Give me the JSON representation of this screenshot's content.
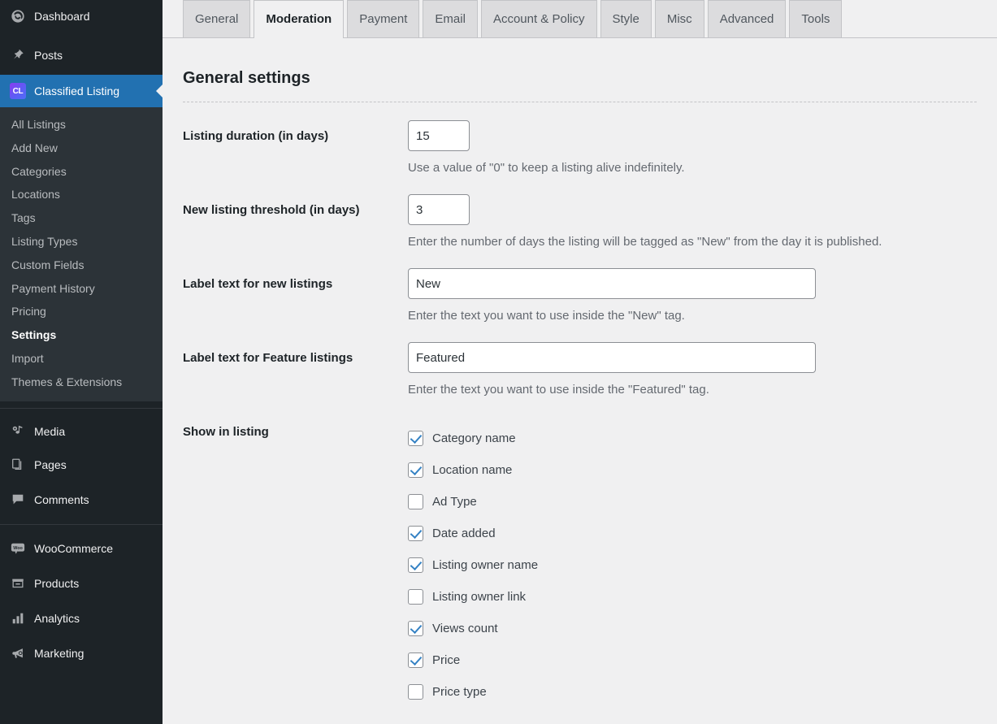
{
  "sidebar": {
    "items": [
      {
        "label": "Dashboard",
        "icon": "dashboard-icon",
        "name": "dashboard"
      },
      {
        "label": "Posts",
        "icon": "pin-icon",
        "name": "posts"
      },
      {
        "label": "Classified Listing",
        "icon": "cl-badge-icon",
        "name": "classified-listing",
        "active": true
      }
    ],
    "submenu": [
      {
        "label": "All Listings",
        "name": "all-listings"
      },
      {
        "label": "Add New",
        "name": "add-new"
      },
      {
        "label": "Categories",
        "name": "categories"
      },
      {
        "label": "Locations",
        "name": "locations"
      },
      {
        "label": "Tags",
        "name": "tags"
      },
      {
        "label": "Listing Types",
        "name": "listing-types"
      },
      {
        "label": "Custom Fields",
        "name": "custom-fields"
      },
      {
        "label": "Payment History",
        "name": "payment-history"
      },
      {
        "label": "Pricing",
        "name": "pricing"
      },
      {
        "label": "Settings",
        "name": "settings",
        "current": true
      },
      {
        "label": "Import",
        "name": "import"
      },
      {
        "label": "Themes & Extensions",
        "name": "themes-extensions"
      }
    ],
    "items_lower": [
      {
        "label": "Media",
        "icon": "media-icon",
        "name": "media"
      },
      {
        "label": "Pages",
        "icon": "pages-icon",
        "name": "pages"
      },
      {
        "label": "Comments",
        "icon": "comments-icon",
        "name": "comments"
      }
    ],
    "items_woo": [
      {
        "label": "WooCommerce",
        "icon": "woo-icon",
        "name": "woocommerce"
      },
      {
        "label": "Products",
        "icon": "products-icon",
        "name": "products"
      },
      {
        "label": "Analytics",
        "icon": "analytics-icon",
        "name": "analytics"
      },
      {
        "label": "Marketing",
        "icon": "marketing-icon",
        "name": "marketing"
      }
    ]
  },
  "tabs": [
    {
      "label": "General",
      "active": false
    },
    {
      "label": "Moderation",
      "active": true
    },
    {
      "label": "Payment",
      "active": false
    },
    {
      "label": "Email",
      "active": false
    },
    {
      "label": "Account & Policy",
      "active": false
    },
    {
      "label": "Style",
      "active": false
    },
    {
      "label": "Misc",
      "active": false
    },
    {
      "label": "Advanced",
      "active": false
    },
    {
      "label": "Tools",
      "active": false
    }
  ],
  "main": {
    "section_title": "General settings",
    "fields": [
      {
        "label": "Listing duration (in days)",
        "value": "15",
        "help": "Use a value of \"0\" to keep a listing alive indefinitely.",
        "name": "listing-duration"
      },
      {
        "label": "New listing threshold (in days)",
        "value": "3",
        "help": "Enter the number of days the listing will be tagged as \"New\" from the day it is published.",
        "name": "new-listing-threshold"
      },
      {
        "label": "Label text for new listings",
        "value": "New",
        "help": "Enter the text you want to use inside the \"New\" tag.",
        "name": "label-text-new-listings"
      },
      {
        "label": "Label text for Feature listings",
        "value": "Featured",
        "help": "Enter the text you want to use inside the \"Featured\" tag.",
        "name": "label-text-feature-listings"
      }
    ],
    "show_in_listing": {
      "label": "Show in listing",
      "options": [
        {
          "label": "Category name",
          "checked": true
        },
        {
          "label": "Location name",
          "checked": true
        },
        {
          "label": "Ad Type",
          "checked": false
        },
        {
          "label": "Date added",
          "checked": true
        },
        {
          "label": "Listing owner name",
          "checked": true
        },
        {
          "label": "Listing owner link",
          "checked": false
        },
        {
          "label": "Views count",
          "checked": true
        },
        {
          "label": "Price",
          "checked": true
        },
        {
          "label": "Price type",
          "checked": false
        }
      ]
    }
  },
  "colors": {
    "sidebar_bg": "#1d2327",
    "submenu_bg": "#2c3338",
    "active_blue": "#2271b1",
    "content_bg": "#f0f0f1",
    "check_blue": "#3582c4"
  }
}
